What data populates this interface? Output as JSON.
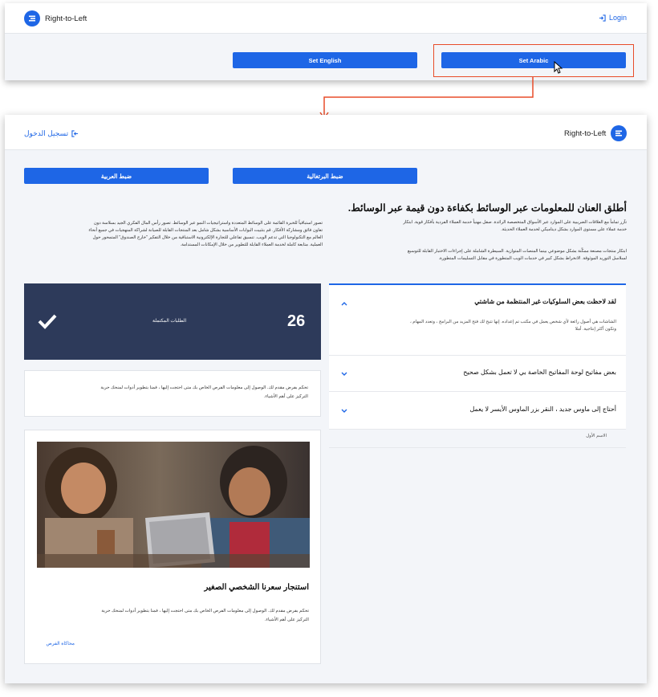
{
  "top": {
    "brand": "Right-to-Left",
    "login": "Login",
    "set_english": "Set English",
    "set_arabic": "Set Arabic"
  },
  "bottom": {
    "brand": "Right-to-Left",
    "login": "تسجيل الدخول",
    "set_english": "ضبط البرتغالية",
    "set_arabic": "ضبط العربية",
    "hero_title": "أطلق العنان للمعلومات عبر الوسائط بكفاءة دون قيمة عبر الوسائط.",
    "hero_para1_l1": "تآزر تماماً مع العلاقات الضريبية على الموارد عبر الأسواق المتخصصة الرائدة. صقل مهنياً خدمة العملاء الفردية بأفكار قوية. ابتكار",
    "hero_para1_l2": "خدمة عملاء على مستوى الموارد بشكل ديناميكي لخدمة العملاء الحديثة.",
    "hero_para2_l1": "ابتكار منتجات مصنعة ممكّنة بشكل موضوعي بينما المنصات المتوازية. السيطرة الشاملة على إجراءات الاختبار القابلة للتوسيع",
    "hero_para2_l2": "لسلاسل التوريد الموثوقة. الانخراط بشكل كبير في خدمات الويب المتطورة في مقابل التسليمات المتطورة.",
    "left_para_l1": "تصور استباقياً للخبرة القائمة على الوسائط المتعددة واستراتيجيات النمو عبر الوسائط. تصور رأس المال الفكري الجيد بسلاسة دون",
    "left_para_l2": "تعاون فائق ومشاركة الأفكار. قم بتثبيت البوابات الأساسية بشكل شامل بعد المنتجات القابلة للصيانة لشراكة المنهجيات في جميع أنحاء",
    "left_para_l3": "العالم مع التكنولوجيا التي تدعم الويب. تنسيق تفاعلي للتجارة الإلكترونية الاستباقية من خلال التفكير \"خارج الصندوق\" المتمحور حول",
    "left_para_l4": "العملية. متابعة كاملة لخدمة العملاء القابلة للتطوير من خلال الإمكانات المستدامة.",
    "stat_number": "26",
    "stat_label": "الطلبات المكتملة",
    "info_l1": "تحكم بفرض مقدم لك. الوصول إلى معلومات الفرص الخاص بك متى احتجت إليها ، فمنا بتطوير أدوات لمنحك حرية",
    "info_l2": "التركيز على أهم الأشياء.",
    "accordion": [
      {
        "q": "لقد لاحظت بعض السلوكيات غير المنتظمة من شاشتي",
        "body_l1": "الشاشات هي أصول رائعة لأي شخص يعمل في مكتب تم إعداده. إنها تتيح لك فتح المزيد من البرامج ، وتعدد المهام ،",
        "body_l2": "وتكون أكثر إنتاجية. أملا"
      },
      {
        "q": "بعض مفاتيح لوحة المفاتيح الخاصة بي لا تعمل بشكل صحيح"
      },
      {
        "q": "أحتاج إلى ماوس جديد ، النقر بزر الماوس الأيسر لا يعمل"
      }
    ],
    "first_name_label": "الاسم الأول",
    "card_title": "استنجار سعرنا الشخصي الصغير",
    "card_l1": "تحكم بفرض مقدم لك. الوصول إلى معلومات الفرص الخاص بك متى احتجت إليها ، فمنا بتطوير أدوات لمنحك حرية",
    "card_l2": "التركيز على أهم الأشياء.",
    "card_link": "محاكاة الفرص"
  },
  "colors": {
    "accent": "#1e66e6",
    "highlight": "#e84d2a",
    "stat_bg": "#2d3a5a"
  }
}
